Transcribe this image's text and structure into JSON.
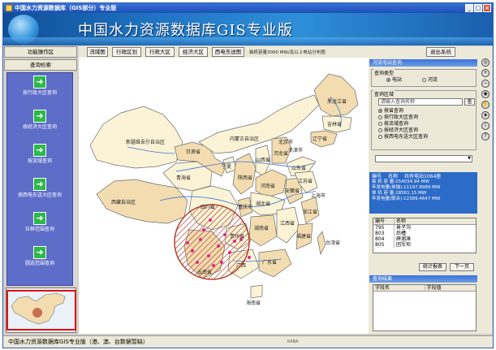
{
  "window": {
    "title": "中国水力资源数据库（GIS部分）专业版",
    "controls": [
      "_",
      "□",
      "×"
    ]
  },
  "banner": {
    "title": "中国水力资源数据库GIS专业版"
  },
  "left_panel": {
    "function_button": "功能操作区",
    "query_button": "查询检索",
    "items": [
      {
        "label": "按行政大区查询",
        "icon": "right-arrow-icon"
      },
      {
        "label": "按经济大区查询",
        "icon": "right-arrow-icon"
      },
      {
        "label": "按流域查询",
        "icon": "right-arrow-icon"
      },
      {
        "label": "按西电东送大区查询",
        "icon": "right-arrow-icon"
      },
      {
        "label": "拉框范围查询",
        "icon": "right-arrow-icon"
      },
      {
        "label": "圆选范围查询",
        "icon": "right-arrow-icon"
      }
    ]
  },
  "map_toolbar": {
    "buttons": [
      "流域图",
      "行政区划",
      "行政大区",
      "经济大区",
      "西电东送图"
    ],
    "note": "装机容量3000 MW/及以上电站分布图",
    "exit": "退出系统"
  },
  "map": {
    "labels": [
      "新疆维吾尔自治区",
      "西藏自治区",
      "青海省",
      "甘肃省",
      "内蒙古自治区",
      "黑龙江省",
      "吉林省",
      "辽宁省",
      "宁夏",
      "陕西省",
      "山西省",
      "河北省",
      "北京市",
      "天津市",
      "山东省",
      "河南省",
      "四川省",
      "重庆市",
      "湖北省",
      "安徽省",
      "江苏省",
      "上海市",
      "浙江省",
      "湖南省",
      "江西省",
      "福建省",
      "贵州省",
      "云南省",
      "广西",
      "广东省",
      "台湾省",
      "海南省"
    ]
  },
  "right_panel": {
    "header": "河流电站查询",
    "query_type": {
      "legend": "查询类型",
      "options": [
        "电站",
        "河流"
      ],
      "selected": "电站"
    },
    "query_region": {
      "legend": "查询区域",
      "input_placeholder": "请输入查询名称",
      "search_button": "查",
      "options": [
        "按省查询",
        "按行政大区查询",
        "按流域查询",
        "按经济大区查询",
        "按西电东送大区查询"
      ],
      "selected": "按省查询"
    },
    "stats": {
      "h1": "编号",
      "h2": "名称",
      "h3": "共有电站1064座",
      "lines": [
        "装 机 容 量:254034.94 MW",
        "年发电量(单独):11197.8989 MW",
        "单 机 容 量:28561.15 MW",
        "年发电量(联合):12389.4647 MW"
      ]
    },
    "table": {
      "columns": [
        "编号",
        "名称"
      ],
      "rows": [
        [
          "795",
          "景子沟"
        ],
        [
          "803",
          "后槽"
        ],
        [
          "804",
          "薛湘滩"
        ],
        [
          "805",
          "团军坝"
        ]
      ]
    },
    "buttons": {
      "stats": "统计报表",
      "next": "下一页"
    },
    "results": {
      "header": "查询结果",
      "columns": [
        "字段名",
        "字段值"
      ]
    }
  },
  "status_bar": {
    "text": "中国水力资源数据库GIS专业版（港、澳、台数据暂缺）",
    "right": "KABA"
  },
  "colors": {
    "titlebar": "#1c4fb5",
    "province_fill": "#f3ddb0",
    "province_alt": "#fbf3d6",
    "circle": "#b3402a",
    "panel_blue": "#5d6dc8"
  }
}
